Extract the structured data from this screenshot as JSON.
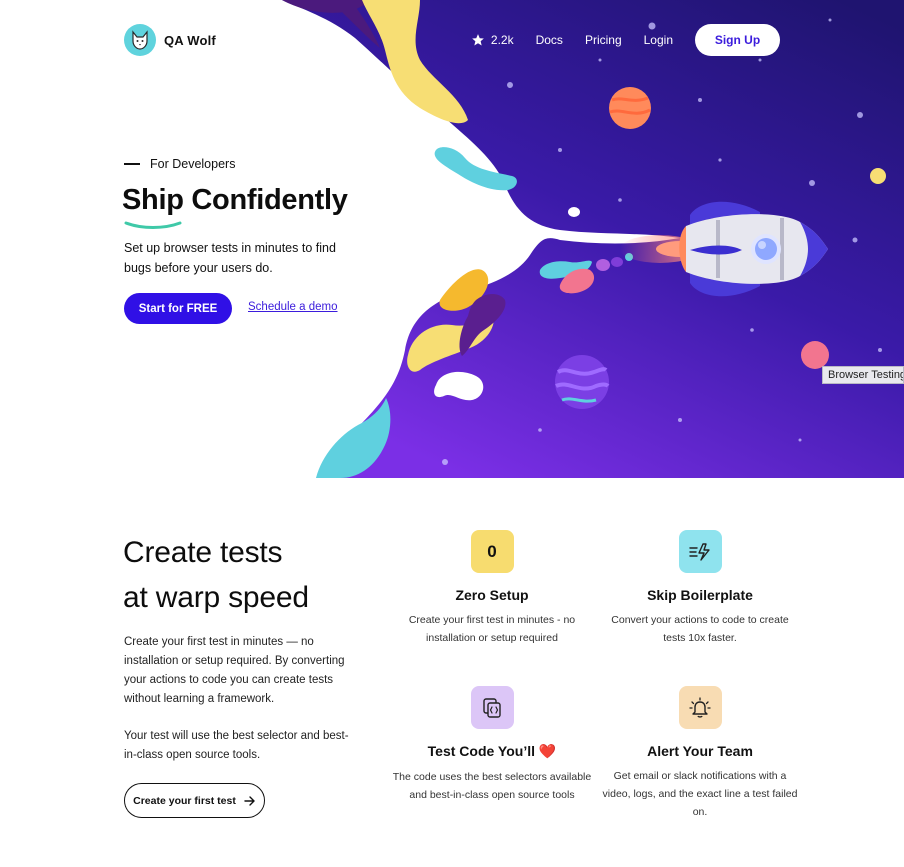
{
  "brand": {
    "name": "QA Wolf",
    "logo_icon": "wolf-icon"
  },
  "nav": {
    "stars": "2.2k",
    "star_icon": "star-icon",
    "docs": "Docs",
    "pricing": "Pricing",
    "login": "Login",
    "signup": "Sign Up"
  },
  "hero": {
    "eyebrow": "For Developers",
    "title": "Ship Confidently",
    "subtitle": "Set up browser tests in minutes to find bugs before your users do.",
    "primary_cta": "Start for FREE",
    "secondary_cta": "Schedule a demo",
    "tooltip": "Browser Testing"
  },
  "features": {
    "title_line1": "Create tests",
    "title_line2": "at warp speed",
    "paragraph1": "Create your first test in minutes — no installation or setup required. By converting your actions to code you can create tests without learning a framework.",
    "paragraph2": "Your test will use the best selector and best-in-class open source tools.",
    "cta": "Create your first test",
    "cards": [
      {
        "icon": "zero-icon",
        "icon_text": "0",
        "title": "Zero Setup",
        "text": "Create your first test in minutes - no installation or setup required"
      },
      {
        "icon": "lightning-icon",
        "title": "Skip Boilerplate",
        "text": "Convert your actions to code to create tests 10x faster."
      },
      {
        "icon": "code-file-icon",
        "title": "Test Code You’ll ❤️",
        "text": "The code uses the best selectors available and best-in-class open source tools"
      },
      {
        "icon": "bell-icon",
        "title": "Alert Your Team",
        "text": "Get email or slack notifications with a video, logs, and the exact line a test failed on."
      }
    ]
  },
  "colors": {
    "primary": "#3010e6",
    "space_dark": "#2a1580",
    "space_light": "#6b2fe0",
    "teal": "#5fd3dd",
    "yellow": "#f7dc6f",
    "lilac": "#dcc6f7",
    "peach": "#f8dcb3"
  }
}
